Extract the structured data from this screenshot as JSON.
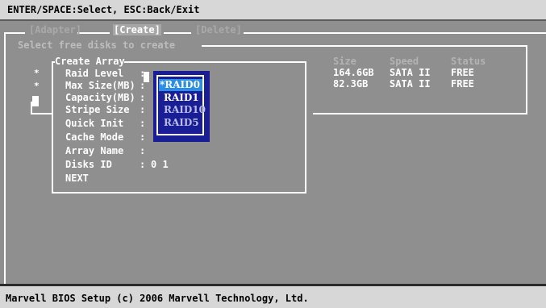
{
  "top_bar": {
    "text": "ENTER/SPACE:Select, ESC:Back/Exit"
  },
  "tabs": [
    {
      "label": "[Adapter]"
    },
    {
      "label": "[Create]"
    },
    {
      "label": "[Delete]"
    }
  ],
  "disk_panel": {
    "title": "Select free disks to create",
    "markers": [
      "*",
      "*"
    ],
    "columns": [
      "Size",
      "Speed",
      "Status"
    ],
    "rows": [
      {
        "size": "164.6GB",
        "speed": "SATA II",
        "status": "FREE"
      },
      {
        "size": "82.3GB",
        "speed": "SATA II",
        "status": "FREE"
      }
    ]
  },
  "create_array": {
    "title": "Create Array",
    "fields": [
      {
        "label": "Raid Level",
        "sep": ":",
        "value": ""
      },
      {
        "label": "Max Size(MB)",
        "sep": ":",
        "value": ""
      },
      {
        "label": "Capacity(MB)",
        "sep": ":",
        "value": ""
      },
      {
        "label": "Stripe Size",
        "sep": ":",
        "value": ""
      },
      {
        "label": "Quick Init",
        "sep": ":",
        "value": ""
      },
      {
        "label": "Cache Mode",
        "sep": ":",
        "value": ""
      },
      {
        "label": "Array Name",
        "sep": ":",
        "value": ""
      },
      {
        "label": "Disks ID",
        "sep": ":",
        "value": "0 1"
      }
    ],
    "next_label": "NEXT"
  },
  "raid_level_options": {
    "items": [
      "*RAID0",
      "RAID1",
      "RAID10",
      "RAID5"
    ],
    "selected_index": 0
  },
  "bottom_bar": {
    "text": "Marvell BIOS Setup (c) 2006 Marvell Technology, Ltd."
  },
  "colors": {
    "background": "#8f8f8f",
    "bar": "#d7d7d7",
    "popup": "#1a1e96",
    "popup_selected": "#2b8ee6",
    "text_white": "#ffffff",
    "text_dim": "#a9a9a9"
  }
}
